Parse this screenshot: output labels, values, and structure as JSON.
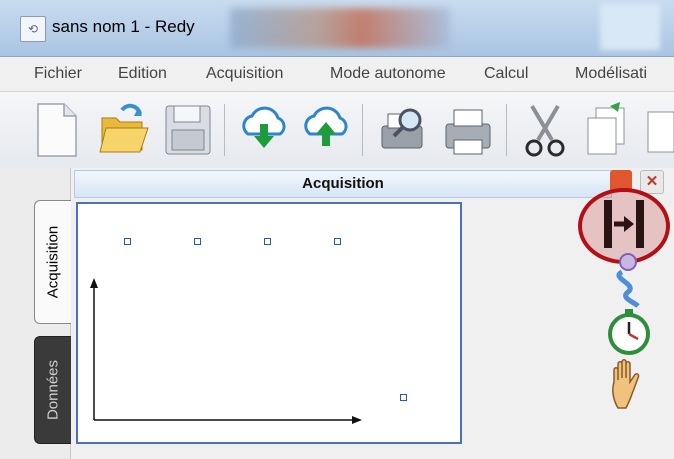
{
  "window": {
    "title": "sans nom 1 - Redy",
    "app_icon": "redy-app-icon"
  },
  "menu": [
    "Fichier",
    "Edition",
    "Acquisition",
    "Mode autonome",
    "Calcul",
    "Modélisati"
  ],
  "toolbar": {
    "buttons": [
      "new-file-icon",
      "open-folder-icon",
      "save-icon",
      "cloud-download-icon",
      "cloud-upload-icon",
      "print-preview-icon",
      "print-icon",
      "cut-icon",
      "copy-icon"
    ]
  },
  "tabs": {
    "active": "Acquisition",
    "inactive": "Données"
  },
  "panel": {
    "title": "Acquisition",
    "close_symbol": "✕"
  },
  "side_tools": [
    "start-acquisition-icon",
    "link-icon",
    "timer-icon",
    "hand-icon"
  ],
  "graph": {
    "points": [
      {
        "x": 1,
        "y": 4
      },
      {
        "x": 2,
        "y": 4
      },
      {
        "x": 3,
        "y": 4
      },
      {
        "x": 4,
        "y": 4
      },
      {
        "x": 5,
        "y": 1
      }
    ]
  },
  "colors": {
    "accent_red": "#b30f16",
    "graph_border": "#4a72b8",
    "window_min": "#e0562f"
  }
}
